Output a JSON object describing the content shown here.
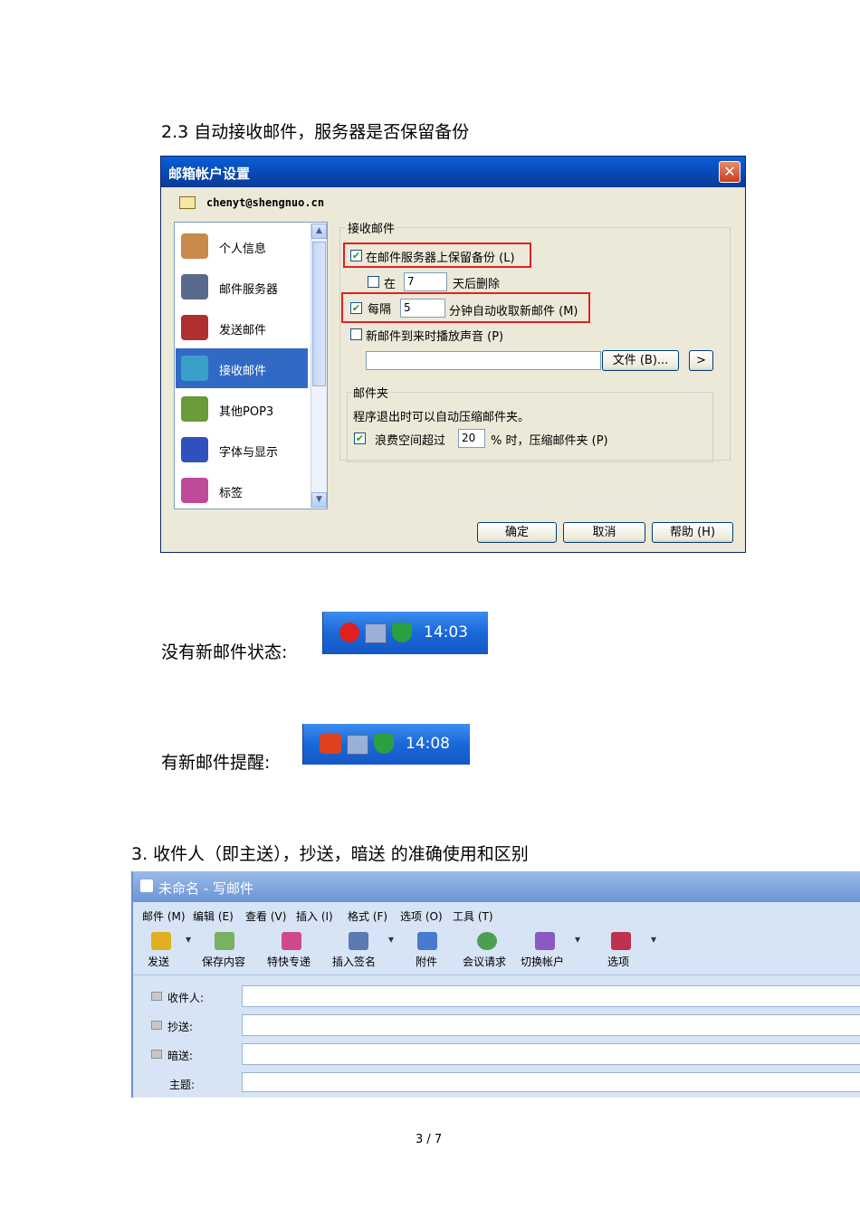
{
  "heading_2_3": "2.3 自动接收邮件，服务器是否保留备份",
  "dialog": {
    "title": "邮箱帐户设置",
    "close_glyph": "✕",
    "account": "chenyt@shengnuo.cn",
    "nav_items": [
      {
        "label": "个人信息",
        "icon": "person-icon",
        "color": "#c88a4a"
      },
      {
        "label": "邮件服务器",
        "icon": "server-icon",
        "color": "#5a6a8a"
      },
      {
        "label": "发送邮件",
        "icon": "send-mail-icon",
        "color": "#b03030"
      },
      {
        "label": "接收邮件",
        "icon": "receive-mail-icon",
        "color": "#3aa0c8"
      },
      {
        "label": "其他POP3",
        "icon": "pop3-icon",
        "color": "#6a9a3a"
      },
      {
        "label": "字体与显示",
        "icon": "font-icon",
        "color": "#3050c0"
      },
      {
        "label": "标签",
        "icon": "tag-icon",
        "color": "#c04a9a"
      }
    ],
    "selected_item": "接收邮件",
    "scroll_up": "▲",
    "scroll_down": "▼",
    "group_receive": "接收邮件",
    "keep_backup_label": "在邮件服务器上保留备份 (L)",
    "keep_backup_checked": true,
    "delete_prefix": "在",
    "delete_days": "7",
    "delete_suffix": "天后删除",
    "delete_checked": false,
    "interval_prefix": "每隔",
    "interval_value": "5",
    "interval_suffix": "分钟自动收取新邮件 (M)",
    "interval_checked": true,
    "sound_label": "新邮件到来时播放声音 (P)",
    "sound_checked": false,
    "file_button": "文件 (B)...",
    "play_button": ">",
    "group_folder": "邮件夹",
    "compress_text": "程序退出时可以自动压缩邮件夹。",
    "waste_prefix": "浪费空间超过",
    "waste_value": "20",
    "waste_suffix": "% 时，压缩邮件夹 (P)",
    "waste_checked": true,
    "check_glyph": "✔",
    "ok_button": "确定",
    "cancel_button": "取消",
    "help_button": "帮助 (H)"
  },
  "no_mail_label": "没有新邮件状态:",
  "no_mail_time": "14:03",
  "new_mail_label": "有新邮件提醒:",
  "new_mail_time": "14:08",
  "heading_3": "3.  收件人（即主送），抄送，暗送   的准确使用和区别",
  "compose": {
    "title": "未命名 - 写邮件",
    "menus": [
      "邮件 (M)",
      "编辑 (E)",
      "查看 (V)",
      "插入 (I)",
      "格式 (F)",
      "选项 (O)",
      "工具 (T)"
    ],
    "toolbar": [
      {
        "label": "发送",
        "icon": "send-icon",
        "color": "#e0b020"
      },
      {
        "label": "保存内容",
        "icon": "save-icon",
        "color": "#7ab060"
      },
      {
        "label": "特快专递",
        "icon": "express-icon",
        "color": "#d04a8a"
      },
      {
        "label": "插入签名",
        "icon": "signature-icon",
        "color": "#5a7ab0"
      },
      {
        "label": "附件",
        "icon": "attachment-icon",
        "color": "#4a7ad0"
      },
      {
        "label": "会议请求",
        "icon": "meeting-icon",
        "color": "#4aa050"
      },
      {
        "label": "切换帐户",
        "icon": "switch-account-icon",
        "color": "#8a5ac0"
      },
      {
        "label": "选项",
        "icon": "options-icon",
        "color": "#c03050"
      }
    ],
    "dropdown_glyph": "▾",
    "fields": [
      {
        "label": "收件人:"
      },
      {
        "label": "抄送:"
      },
      {
        "label": "暗送:"
      },
      {
        "label": "主题:"
      }
    ]
  },
  "page_number": "3 / 7"
}
